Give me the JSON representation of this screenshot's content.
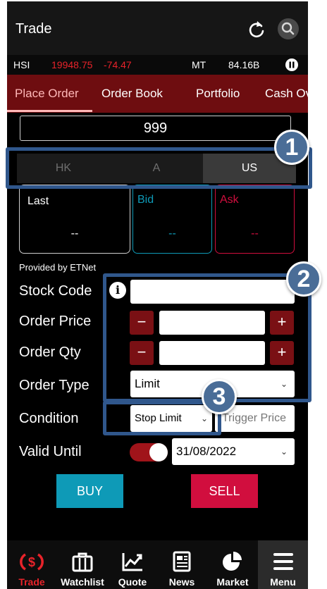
{
  "header": {
    "title": "Trade"
  },
  "ticker": {
    "index": "HSI",
    "price": "19948.75",
    "change": "-74.47",
    "turnover_label": "MT",
    "turnover": "84.16B"
  },
  "tabs": [
    {
      "label": "Place Order"
    },
    {
      "label": "Order Book"
    },
    {
      "label": "Portfolio"
    },
    {
      "label": "Cash Ov"
    }
  ],
  "stock_search": {
    "value": "999"
  },
  "markets": [
    {
      "label": "HK"
    },
    {
      "label": "A"
    },
    {
      "label": "US"
    }
  ],
  "quotes": {
    "last": {
      "label": "Last",
      "value": "--"
    },
    "bid": {
      "label": "Bid",
      "value": "--"
    },
    "ask": {
      "label": "Ask",
      "value": "--"
    }
  },
  "provided_by": "Provided by ETNet",
  "form": {
    "stock_code_label": "Stock Code",
    "order_price_label": "Order Price",
    "order_qty_label": "Order Qty",
    "order_type_label": "Order Type",
    "order_type_value": "Limit",
    "condition_label": "Condition",
    "condition_value": "Stop Limit",
    "trigger_price_placeholder": "Trigger Price",
    "valid_until_label": "Valid Until",
    "valid_until_value": "31/08/2022",
    "minus": "−",
    "plus": "+",
    "chevron": "⌄"
  },
  "actions": {
    "buy": "BUY",
    "sell": "SELL"
  },
  "nav": [
    {
      "label": "Trade",
      "icon": "dollar-refresh-icon"
    },
    {
      "label": "Watchlist",
      "icon": "briefcase-icon"
    },
    {
      "label": "Quote",
      "icon": "line-chart-icon"
    },
    {
      "label": "News",
      "icon": "newspaper-icon"
    },
    {
      "label": "Market",
      "icon": "pie-chart-icon"
    },
    {
      "label": "Menu",
      "icon": "hamburger-icon"
    }
  ],
  "callouts": [
    "1",
    "2",
    "3"
  ],
  "colors": {
    "accent": "#e8232a",
    "buy": "#0e9ab7",
    "sell": "#d10e3e",
    "callout": "#30578c"
  }
}
